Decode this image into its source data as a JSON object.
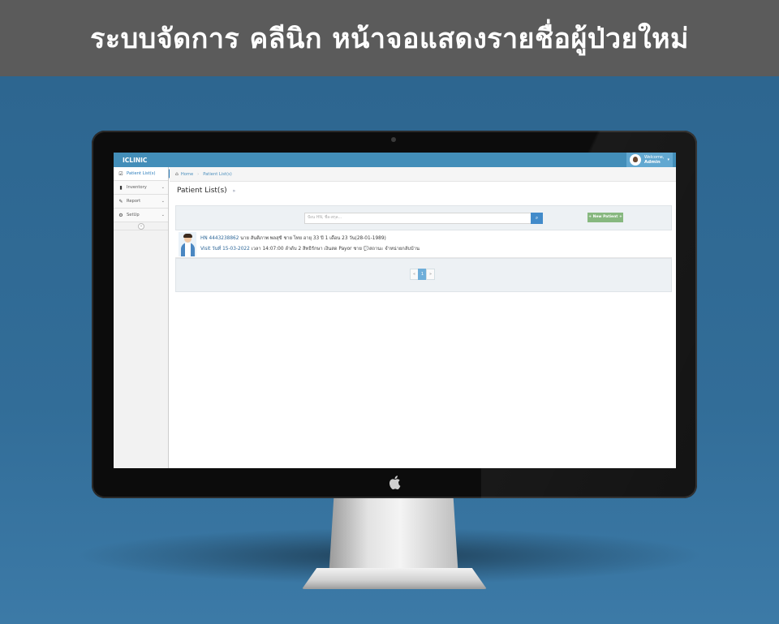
{
  "banner": {
    "title": "ระบบจัดการ คลีนิก หน้าจอแสดงรายชื่อผู้ป่วยใหม่"
  },
  "app": {
    "brand": "ICLINIC",
    "user": {
      "greeting": "Welcome,",
      "name": "Admin"
    }
  },
  "sidebar": {
    "items": [
      {
        "label": "Patient List(s)",
        "icon": "check-square-icon",
        "active": true
      },
      {
        "label": "Inventory",
        "icon": "file-icon",
        "active": false
      },
      {
        "label": "Report",
        "icon": "edit-icon",
        "active": false
      },
      {
        "label": "SetUp",
        "icon": "gear-icon",
        "active": false
      }
    ]
  },
  "breadcrumb": {
    "home": "Home",
    "current": "Patient List(s)"
  },
  "page": {
    "title": "Patient List(s)",
    "subtitle": "»"
  },
  "search": {
    "placeholder": "ป้อน HN, ชื่อ-สกุล...",
    "new_button": "+ New Patient +"
  },
  "patients": [
    {
      "hn_label": "HN 4443238862",
      "info": " นาย สันติภาพ พลสุขี ชาย ไทย อายุ 33 ปี 1 เดือน 23 วัน(28-01-1989)",
      "visit_label": "Visit วันที่ 15-03-2022",
      "visit_info": " เวลา 14:07:00 ลำดับ 2 สิทธิรักษา เงินสด Payor ชาย 💬สถานะ จำหน่ายกลับบ้าน"
    }
  ],
  "pagination": {
    "prev": "«",
    "current": "1",
    "next": "»"
  }
}
